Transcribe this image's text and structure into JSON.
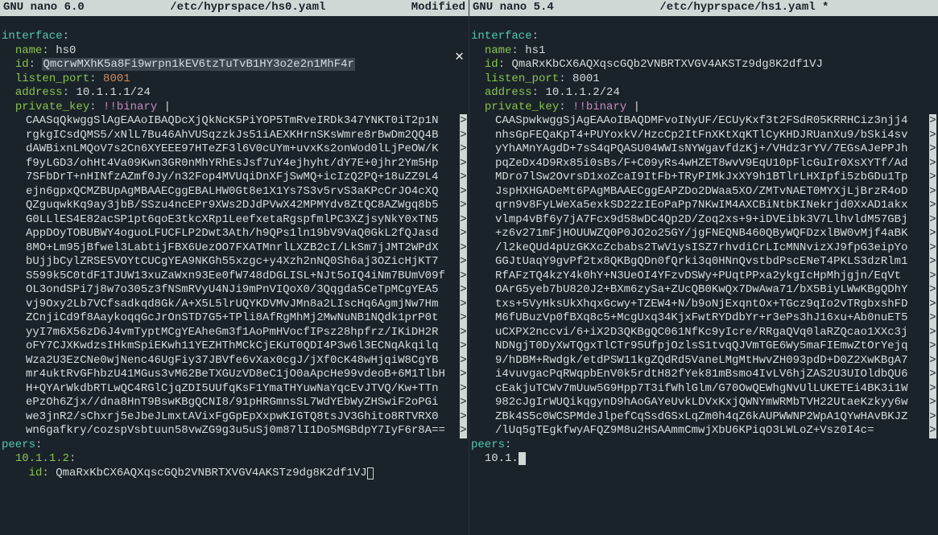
{
  "left": {
    "app": "GNU nano 6.0",
    "file": "/etc/hyprspace/hs0.yaml",
    "status": "Modified",
    "interface_label": "interface",
    "name_label": "name",
    "name_val": "hs0",
    "id_label": "id",
    "id_val": "QmcrwMXhK5a8Fi9wrpn1kEV6tzTuTvB1HY3o2e2n1MhF4r",
    "listen_port_label": "listen_port",
    "listen_port_val": "8001",
    "address_label": "address",
    "address_val": "10.1.1.1/24",
    "private_key_label": "private_key",
    "binary_tag": "!!binary",
    "binary": [
      "CAASqQkwggSlAgEAAoIBAQDcXjQkNcK5PiYOP5TmRveIRDk347YNKT0iT2p1N",
      "rgkgICsdQMS5/xNlL7Bu46AhVUSqzzkJs51iAEXKHrnSKsWmre8rBwDm2QQ4B",
      "dAWBixnLMQoV7s2Cn6XYEEE97HTeZF3l6V0cUYm+uvxKs2onWod0lLjPeOW/K",
      "f9yLGD3/ohHt4Va09Kwn3GR0nMhYRhEsJsf7uY4ejhyht/dY7E+0jhr2Ym5Hp",
      "7SFbDrT+nHINfzAZmf0Jy/n32Fop4MVUqiDnXFjSwMQ+icIzQ2PQ+18uZZ9L4",
      "ejn6gpxQCMZBUpAgMBAAECggEBALHW0Gt8e1X1Ys7S3v5rvS3aKPcCrJO4cXQ",
      "QZguqwkKq9ay3jbB/SSzu4ncEPr9XWs2DJdPVwX42MPMYdv8ZtQC8AZWgq8b5",
      "G0LLlES4E82acSP1pt6qoE3tkcXRp1LeefxetaRgspfmlPC3XZjsyNkY0xTN5",
      "AppDOyTOBUBWY4oguoLFUCFLP2Dwt3Ath/h9QPs1ln19bV9VaQ0GkL2fQJasd",
      "8MO+Lm95jBfwel3LabtijFBX6UezOO7FXATMnrlLXZB2cI/LkSm7jJMT2WPdX",
      "bUjjbCylZRSE5VOYtCUCgYEA9NKGh55xzgc+y4Xzh2nNQ0Sh6aj3OZicHjKT7",
      "S599k5C0tdF1TJUW13xuZaWxn93Ee0fW748dDGLISL+NJt5oIQ4iNm7BUmV09f",
      "OL3ondSPi7j8w7o305z3fNSmRVyU4NJi9mPnVIQoX0/3Qqgda5CeTpMCgYEA5",
      "vj9Oxy2Lb7VCfsadkqd8Gk/A+X5L5lrUQYKDVMvJMn8a2LIscHq6AgmjNw7Hm",
      "ZCnjiCd9f8AaykoqqGcJrOnSTD7G5+TPli8AfRgMhMj2MwNuNB1NQdk1prP0t",
      "yyI7m6X56zD6J4vmTyptMCgYEAheGm3f1AoPmHVocfIPsz28hpfrz/IKiDH2R",
      "oFY7CJXKwdzsIHkmSpiEKwh11YEZHThMCkCjEKuT0QDI4P3w6l3ECNqAkqilq",
      "Wza2U3EzCNe0wjNenc46UgFiy37JBVfe6vXax0cgJ/jXf0cK48wHjqiW8CgYB",
      "mr4uktRvGFhbzU41MGus3vM62BeTXGUzVD8eC1jO0aApcHe99vdeoB+6M1TlbH",
      "H+QYArWkdbRTLwQC4RGlCjqZDI5UUfqKsF1YmaTHYuwNaYqcEvJTVQ/Kw+TTn",
      "ePzOh6Zjx//dna8HnT9BswKBgQCNI8/91pHRGmnsSL7WdYEbWyZHSwiF2oPGi",
      "we3jnR2/sChxrj5eJbeJLmxtAVixFgGpEpXxpwKIGTQ8tsJV3Ghito8RTVRX0",
      "wn6gafkry/cozspVsbtuun58vwZG9g3u5uSj0m87lI1Do5MGBdpY7IyF6r8A=="
    ],
    "peers_label": "peers",
    "peer_ip": "10.1.1.2",
    "peer_id_label": "id",
    "peer_id_val": "QmaRxKbCX6AQXqscGQb2VNBRTXVGV4AKSTz9dg8K2df1VJ"
  },
  "right": {
    "app": "GNU nano 5.4",
    "file": "/etc/hyprspace/hs1.yaml *",
    "status": "",
    "interface_label": "interface",
    "name_label": "name",
    "name_val": "hs1",
    "id_label": "id",
    "id_val": "QmaRxKbCX6AQXqscGQb2VNBRTXVGV4AKSTz9dg8K2df1VJ",
    "listen_port_label": "listen_port",
    "listen_port_val": "8001",
    "address_label": "address",
    "address_val": "10.1.1.2/24",
    "private_key_label": "private_key",
    "binary_tag": "!!binary",
    "binary": [
      "CAASpwkwggSjAgEAAoIBAQDMFvoINyUF/ECUyKxf3t2FSdR05KRRHCiz3njj4",
      "nhsGpFEQaKpT4+PUYoxkV/HzcCp2ItFnXKtXqKTlCyKHDJRUanXu9/bSki4sv",
      "yYhAMnYAgdD+7sS4qPQASU04WWIsNYWgavfdzKj+/VHdz3rYV/7EGsAJePPJh",
      "pqZeDx4D9Rx85i0sBs/F+C09yRs4wHZET8wvV9EqU10pFlcGuIr0XsXYTf/Ad",
      "MDro7lSw2OvrsD1xoZcaI9ItFb+TRyPIMkJxXY9h1BTlrLHXIpfi5zbGDu1Tp",
      "JspHXHGADeMt6PAgMBAAECggEAPZDo2DWaa5XO/ZMTvNAET0MYXjLjBrzR4oD",
      "qrn9v8FyLWeXa5exkSD22zIEoPaPp7NKwIM4AXCBiNtbKINekrjd0XxAD1akx",
      "vlmp4vBf6y7jA7Fcx9d58wDC4Qp2D/Zoq2xs+9+iDVEibk3V7LlhvldM57GBj",
      "+z6v271mFjHOUUWZQ0P0JO2o25GY/jgFNEQNB460QByWQFDzxlBW0vMjf4aBK",
      "/l2keQUd4pUzGKXcZcbabs2TwV1ysISZ7rhvdiCrLIcMNNvizXJ9fpG3eipYo",
      "GGJtUaqY9gvPf2tx8QKBgQDn0fQrki3q0HNnQvstbdPscENeT4PKLS3dzRlm1",
      "RfAFzTQ4kzY4k0hY+N3UeOI4YFzvDSWy+PUqtPPxa2ykgIcHpMhjgjn/EqVt",
      "OArG5yeb7bU820J2+BXm6zySa+ZUcQB0KwQx7DwAwa71/bX5BiyLWwKBgQDhY",
      "txs+5VyHksUkXhqxGcwy+TZEW4+N/b9oNjExqntOx+TGcz9qIo2vTRgbxshFD",
      "M6fUBuzVp0fBXq8c5+McgUxq34KjxFwtRYDdbYr+r3ePs3hJ16xu+Ab0nuET5",
      "uCXPX2nccvi/6+iX2D3QKBgQC061NfKc9yIcre/RRgaQVq0laRZQcao1XXc3j",
      "NDNgjT0DyXwTQgxTlCTr95UfpjOzlsS1tvqQJVmTGE6Wy5maFIEmwZtOrYejq",
      "9/hDBM+Rwdgk/etdPSW11kgZQdRd5VaneLMgMtHwvZH093pdD+D0Z2XwKBgA7",
      "i4vuvgacPqRWqpbEnV0k5rdtH82fYek81mBsmo4IvLV6hjZAS2U3UIOldbQU6",
      "cEakjuTCWv7mUuw5G9Hpp7T3ifWhlGlm/G70OwQEWhgNvUlLUKETEi4BK3i1W",
      "982cJgIrWUQikqgynD9hAoGAYeUvkLDVxKxjQWNYmWRMbTVH22UtaeKzkyy6w",
      "ZBk4S5c0WCSPMdeJlpefCqSsdGSxLqZm0h4qZ6kAUPWWNP2WpA1QYwHAvBKJZ",
      "/lUq5gTEgkfwyAFQZ9M8u2HSAAmmCmwjXbU6KPiqO3LWLoZ+Vsz0I4c="
    ],
    "peers_label": "peers",
    "peer_ip_partial": "10.1."
  }
}
